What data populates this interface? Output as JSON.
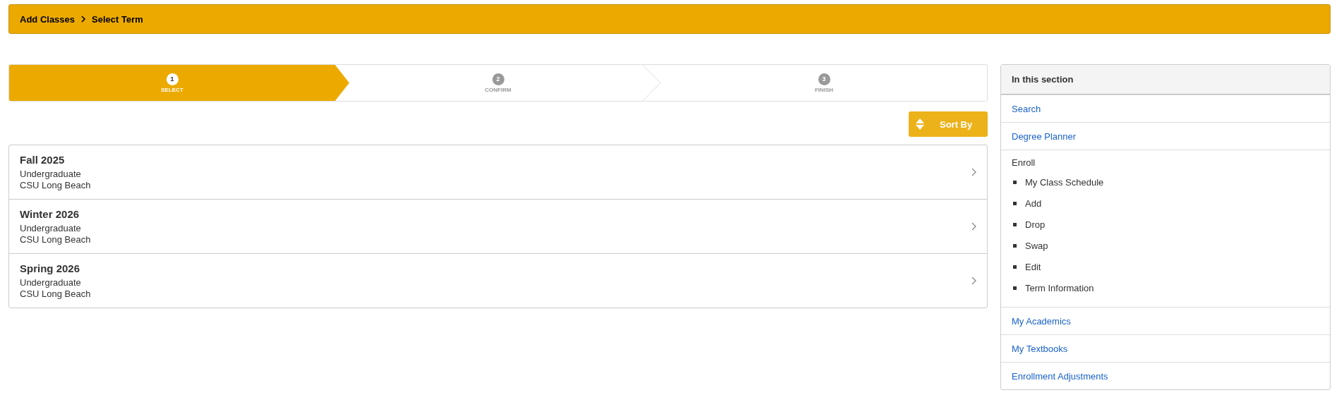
{
  "breadcrumb": [
    "Add Classes",
    "Select Term"
  ],
  "steps": [
    {
      "number": "1",
      "label": "SELECT",
      "selected": true
    },
    {
      "number": "2",
      "label": "CONFIRM",
      "selected": false
    },
    {
      "number": "3",
      "label": "FINISH",
      "selected": false
    }
  ],
  "sort_button": {
    "label": "Sort By"
  },
  "terms": [
    {
      "title": "Fall 2025",
      "career": "Undergraduate",
      "campus": "CSU Long Beach"
    },
    {
      "title": "Winter 2026",
      "career": "Undergraduate",
      "campus": "CSU Long Beach"
    },
    {
      "title": "Spring 2026",
      "career": "Undergraduate",
      "campus": "CSU Long Beach"
    }
  ],
  "sidebar": {
    "title": "In this section",
    "items": [
      {
        "kind": "link",
        "label": "Search"
      },
      {
        "kind": "link",
        "label": "Degree Planner"
      },
      {
        "kind": "group",
        "label": "Enroll",
        "children": [
          {
            "label": "My Class Schedule"
          },
          {
            "label": "Add"
          },
          {
            "label": "Drop"
          },
          {
            "label": "Swap"
          },
          {
            "label": "Edit"
          },
          {
            "label": "Term Information"
          }
        ]
      },
      {
        "kind": "link",
        "label": "My Academics"
      },
      {
        "kind": "link",
        "label": "My Textbooks"
      },
      {
        "kind": "link",
        "label": "Enrollment Adjustments"
      }
    ]
  }
}
